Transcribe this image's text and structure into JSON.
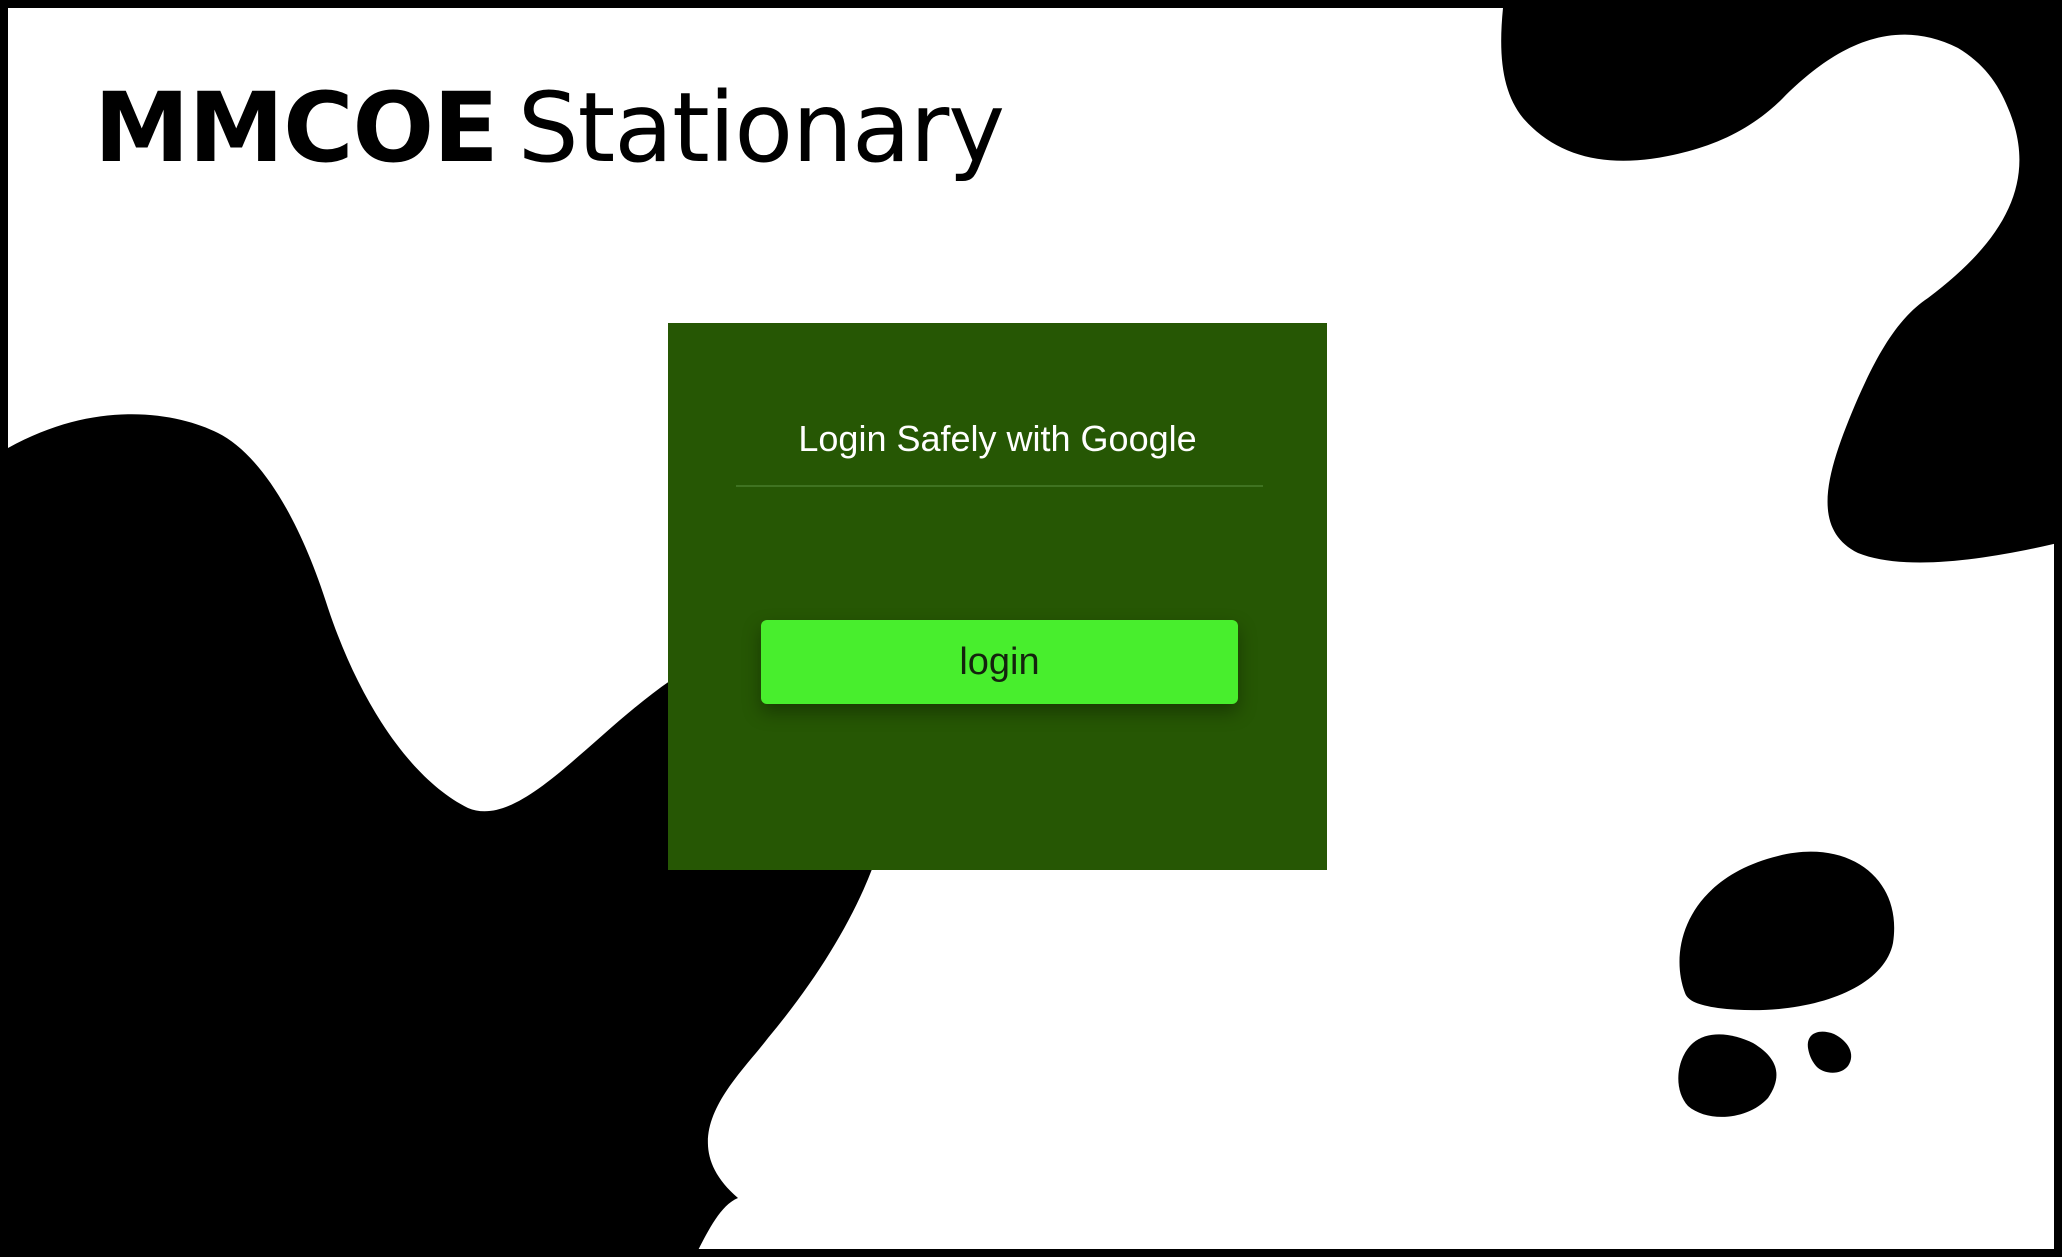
{
  "brand": {
    "bold": "MMCOE",
    "light": "Stationary"
  },
  "login_card": {
    "title": "Login Safely with Google",
    "button_label": "login",
    "background_color": "#265704",
    "button_color": "#48ee2d"
  },
  "decorations": {
    "blob_color": "#000000"
  }
}
